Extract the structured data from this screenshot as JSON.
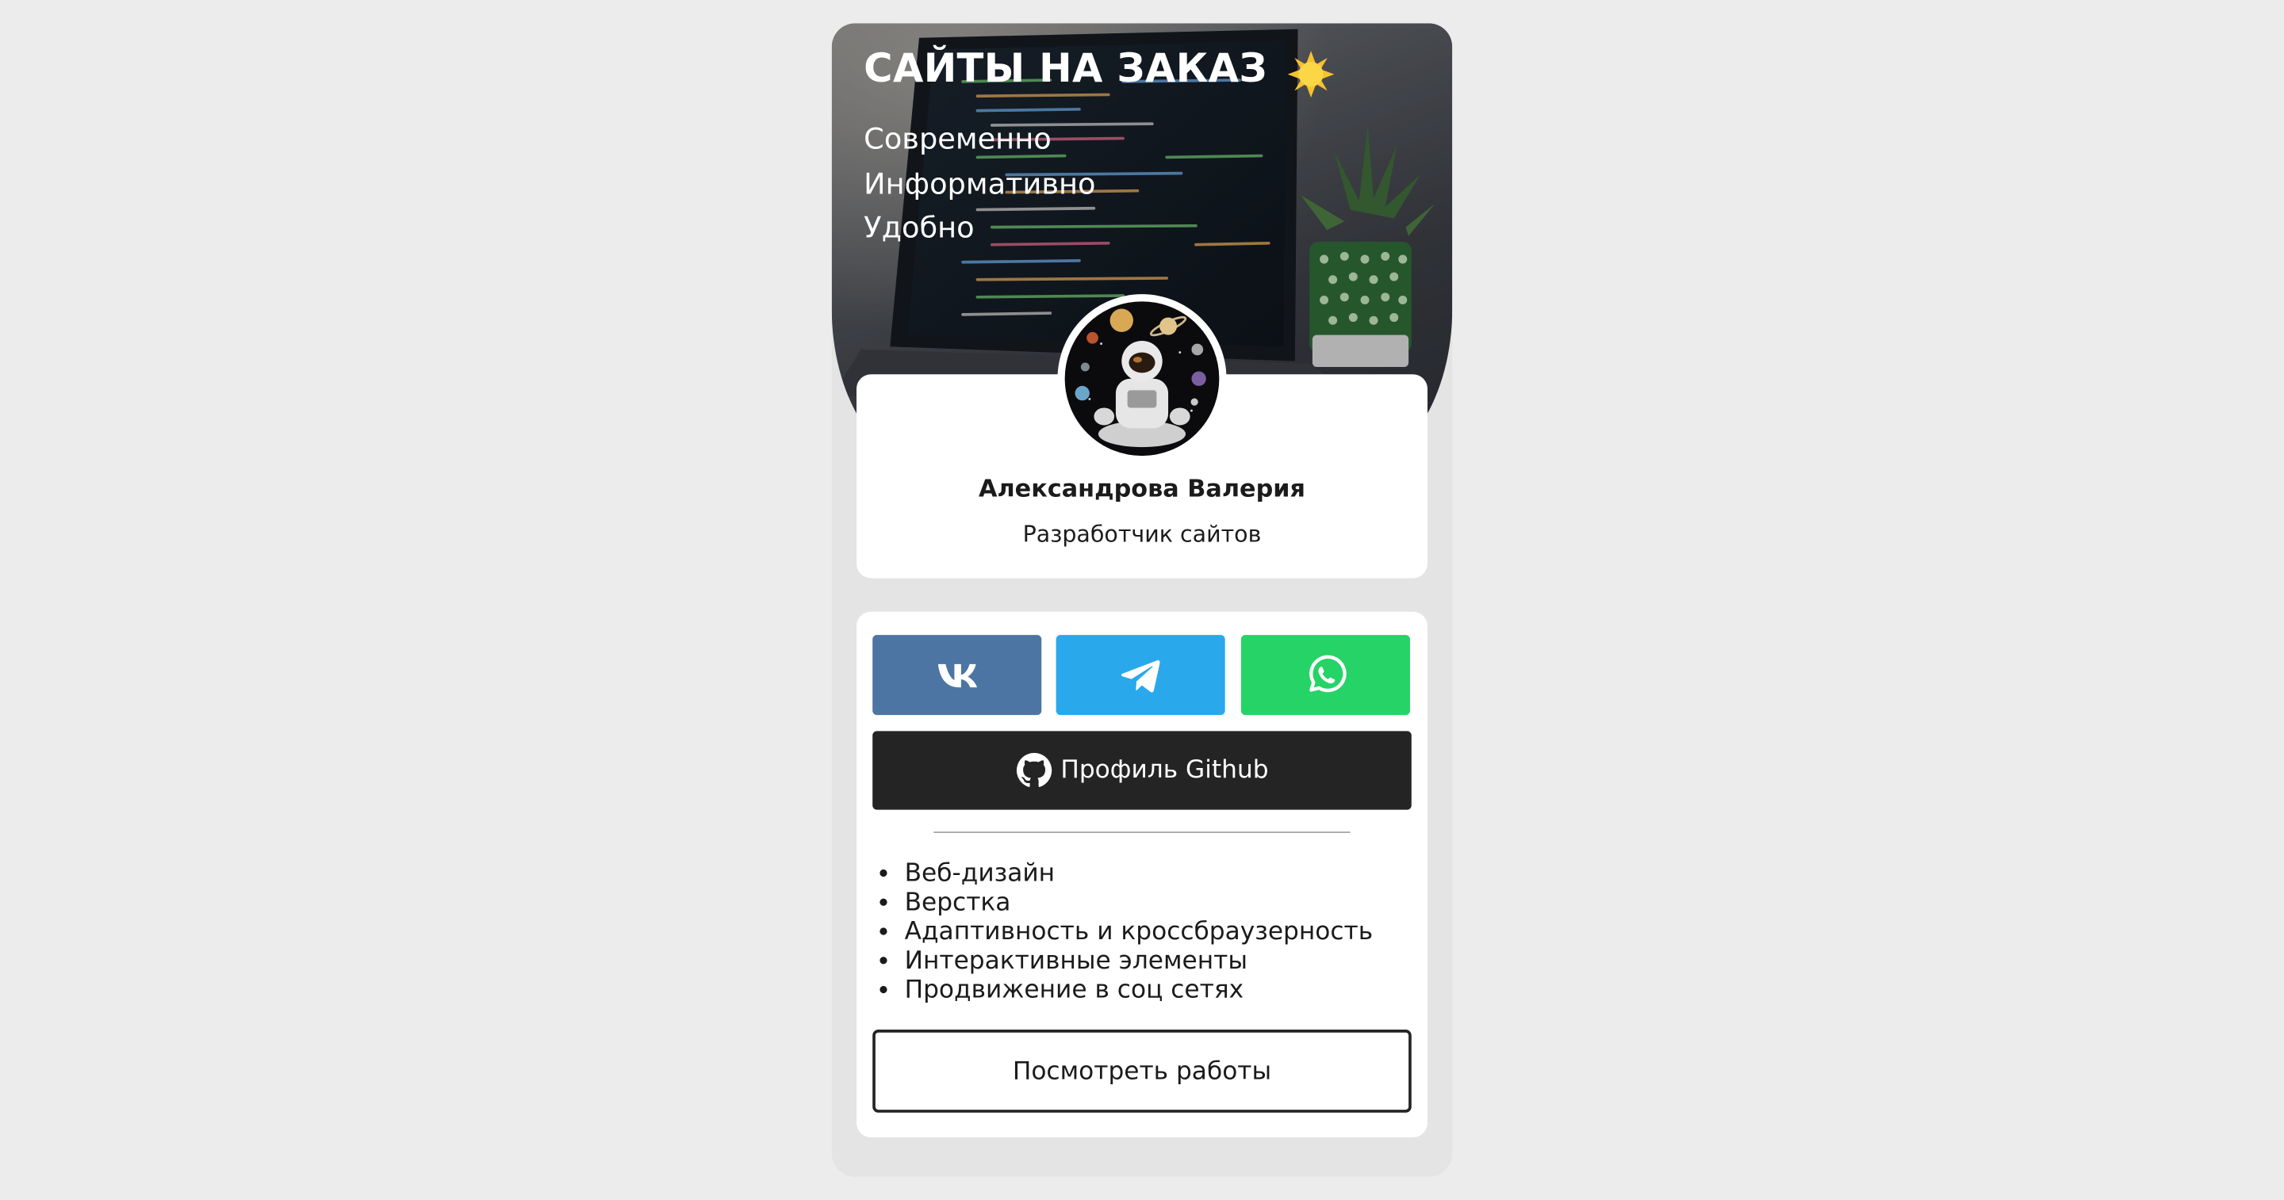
{
  "hero": {
    "title": "САЙТЫ НА ЗАКАЗ",
    "tagline": [
      "Современно",
      "Информативно",
      "Удобно"
    ]
  },
  "profile": {
    "name": "Александрова Валерия",
    "role": "Разработчик сайтов"
  },
  "social": {
    "vk": {
      "icon": "vk-icon",
      "color": "#4c75a3"
    },
    "telegram": {
      "icon": "telegram-icon",
      "color": "#29a9eb"
    },
    "whatsapp": {
      "icon": "whatsapp-icon",
      "color": "#25d366"
    }
  },
  "github": {
    "label": "Профиль Github",
    "icon": "github-icon",
    "color": "#242424"
  },
  "services": [
    "Веб-дизайн",
    "Верстка",
    "Адаптивность и кроссбраузерность",
    "Интерактивные элементы",
    "Продвижение в соц сетях"
  ],
  "works_button": {
    "label": "Посмотреть работы"
  },
  "colors": {
    "page_bg": "#ececec",
    "card_bg": "#e4e4e4"
  }
}
